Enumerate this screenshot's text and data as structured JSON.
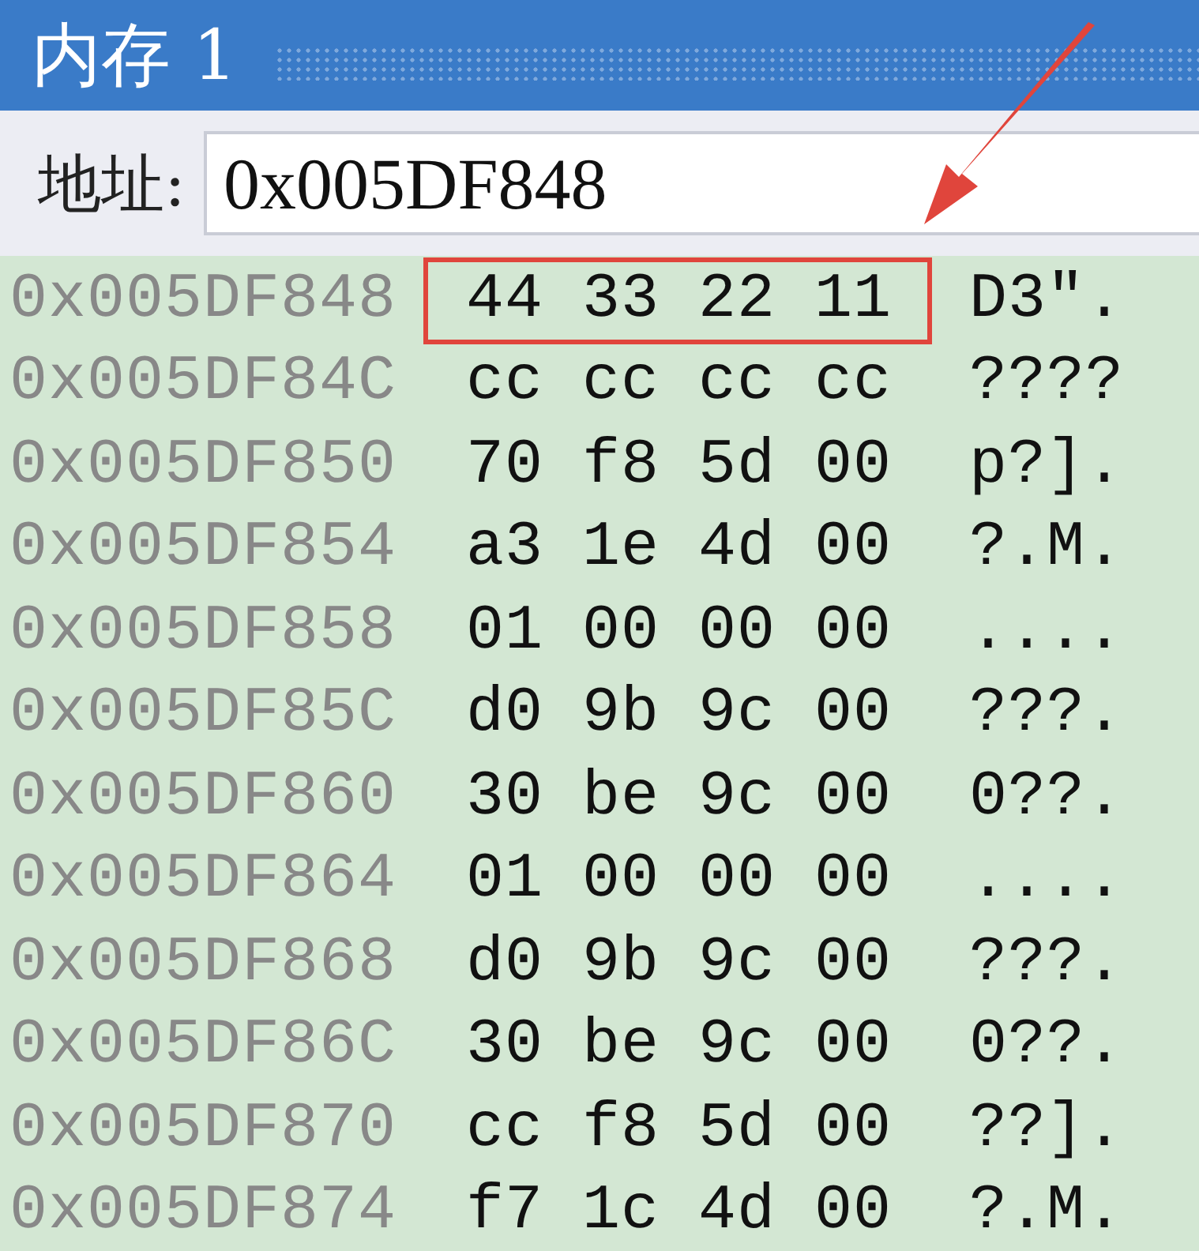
{
  "window": {
    "title": "内存 1"
  },
  "address_bar": {
    "label": "地址:",
    "value": "0x005DF848"
  },
  "rows": [
    {
      "address": "0x005DF848",
      "bytes": "44 33 22 11",
      "ascii": "D3\".",
      "highlighted": true
    },
    {
      "address": "0x005DF84C",
      "bytes": "cc cc cc cc",
      "ascii": "????",
      "highlighted": false
    },
    {
      "address": "0x005DF850",
      "bytes": "70 f8 5d 00",
      "ascii": "p?].",
      "highlighted": false
    },
    {
      "address": "0x005DF854",
      "bytes": "a3 1e 4d 00",
      "ascii": "?.M.",
      "highlighted": false
    },
    {
      "address": "0x005DF858",
      "bytes": "01 00 00 00",
      "ascii": "....",
      "highlighted": false
    },
    {
      "address": "0x005DF85C",
      "bytes": "d0 9b 9c 00",
      "ascii": "???.",
      "highlighted": false
    },
    {
      "address": "0x005DF860",
      "bytes": "30 be 9c 00",
      "ascii": "0??.",
      "highlighted": false
    },
    {
      "address": "0x005DF864",
      "bytes": "01 00 00 00",
      "ascii": "....",
      "highlighted": false
    },
    {
      "address": "0x005DF868",
      "bytes": "d0 9b 9c 00",
      "ascii": "???.",
      "highlighted": false
    },
    {
      "address": "0x005DF86C",
      "bytes": "30 be 9c 00",
      "ascii": "0??.",
      "highlighted": false
    },
    {
      "address": "0x005DF870",
      "bytes": "cc f8 5d 00",
      "ascii": "??].",
      "highlighted": false
    },
    {
      "address": "0x005DF874",
      "bytes": "f7 1c 4d 00",
      "ascii": "?.M.",
      "highlighted": false
    }
  ]
}
